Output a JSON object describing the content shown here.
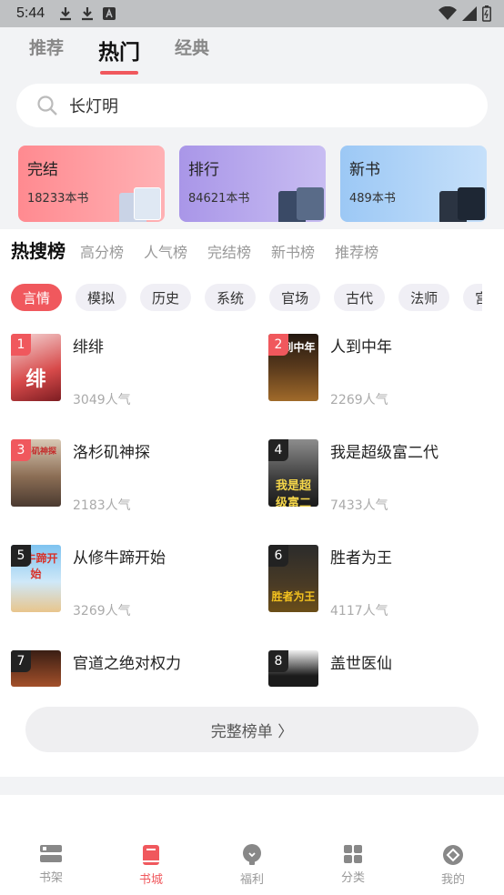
{
  "status_bar": {
    "time": "5:44"
  },
  "top_tabs": [
    {
      "label": "推荐",
      "active": false
    },
    {
      "label": "热门",
      "active": true
    },
    {
      "label": "经典",
      "active": false
    }
  ],
  "search": {
    "text": "长灯明"
  },
  "category_cards": [
    {
      "title": "完结",
      "count": "18233本书"
    },
    {
      "title": "排行",
      "count": "84621本书"
    },
    {
      "title": "新书",
      "count": "489本书"
    }
  ],
  "rank_tabs": [
    {
      "label": "热搜榜",
      "active": true
    },
    {
      "label": "高分榜"
    },
    {
      "label": "人气榜"
    },
    {
      "label": "完结榜"
    },
    {
      "label": "新书榜"
    },
    {
      "label": "推荐榜"
    }
  ],
  "chips": [
    "言情",
    "模拟",
    "历史",
    "系统",
    "官场",
    "古代",
    "法师",
    "宫"
  ],
  "books": [
    {
      "rank": "1",
      "title": "绯绯",
      "popularity": "3049人气",
      "cover_text": "绯"
    },
    {
      "rank": "2",
      "title": "人到中年",
      "popularity": "2269人气",
      "cover_text": "人到中年"
    },
    {
      "rank": "3",
      "title": "洛杉矶神探",
      "popularity": "2183人气",
      "cover_text": "洛杉矶神探"
    },
    {
      "rank": "4",
      "title": "我是超级富二代",
      "popularity": "7433人气",
      "cover_text": "我是超级富二代"
    },
    {
      "rank": "5",
      "title": "从修牛蹄开始",
      "popularity": "3269人气",
      "cover_text": "修牛蹄开始"
    },
    {
      "rank": "6",
      "title": "胜者为王",
      "popularity": "4117人气",
      "cover_text": "胜者为王"
    },
    {
      "rank": "7",
      "title": "官道之绝对权力",
      "popularity": "",
      "cover_text": ""
    },
    {
      "rank": "8",
      "title": "盖世医仙",
      "popularity": "",
      "cover_text": ""
    }
  ],
  "full_list_button": "完整榜单 〉",
  "bottom_nav": [
    {
      "label": "书架",
      "icon": "bookshelf-icon"
    },
    {
      "label": "书城",
      "icon": "book-city-icon",
      "active": true
    },
    {
      "label": "福利",
      "icon": "welfare-icon"
    },
    {
      "label": "分类",
      "icon": "category-icon"
    },
    {
      "label": "我的",
      "icon": "profile-icon"
    }
  ],
  "colors": {
    "accent": "#f0585d",
    "card_finished": "#ff8c92",
    "card_rank": "#b4a3e8",
    "card_new": "#9fcaf5"
  }
}
